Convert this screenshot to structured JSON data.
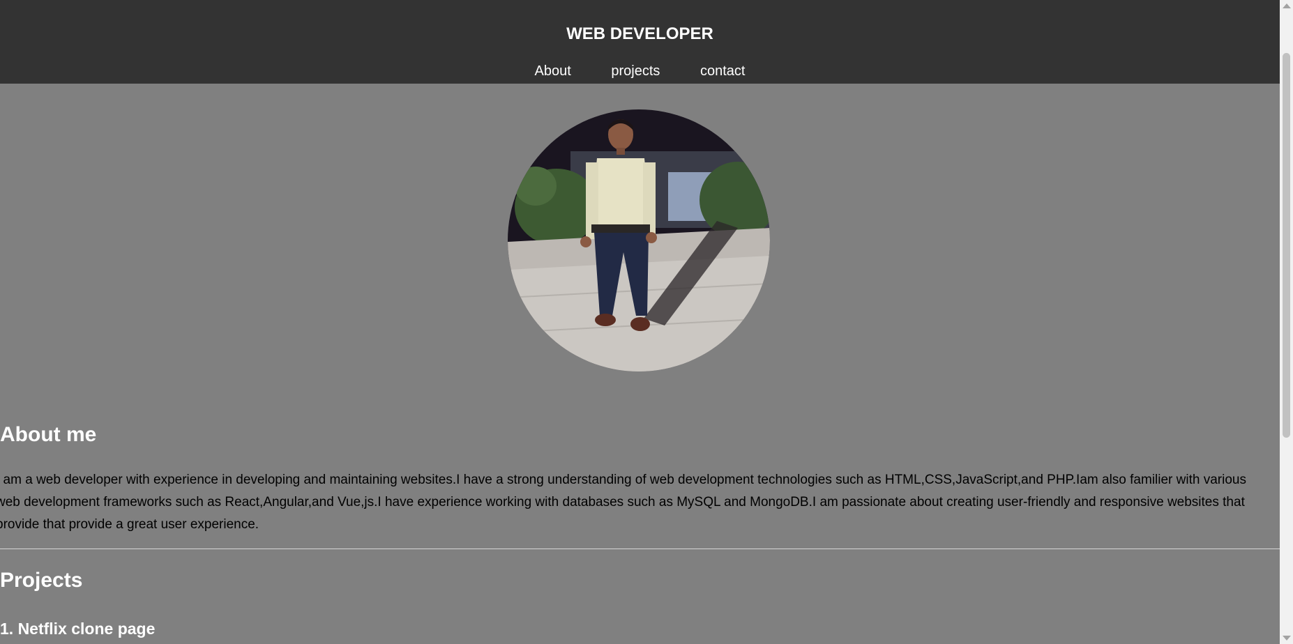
{
  "header": {
    "title": "WEB DEVELOPER",
    "nav": [
      {
        "label": "About"
      },
      {
        "label": "projects"
      },
      {
        "label": "contact"
      }
    ]
  },
  "profile": {
    "image": "profile-photo"
  },
  "about": {
    "heading": "About me",
    "text": "I am a web developer with experience in developing and maintaining websites.I have a strong understanding of web development technologies such as HTML,CSS,JavaScript,and PHP.Iam also familier with various web development frameworks such as React,Angular,and Vue,js.I have experience working with databases such as MySQL and MongoDB.I am passionate about creating user-friendly and responsive websites that provide that provide a great user experience."
  },
  "projects": {
    "heading": "Projects",
    "items": [
      {
        "label": "1. Netflix clone page"
      }
    ]
  },
  "colors": {
    "header_bg": "#333333",
    "page_bg": "#808080",
    "heading_text": "#ffffff",
    "body_text": "#000000"
  }
}
